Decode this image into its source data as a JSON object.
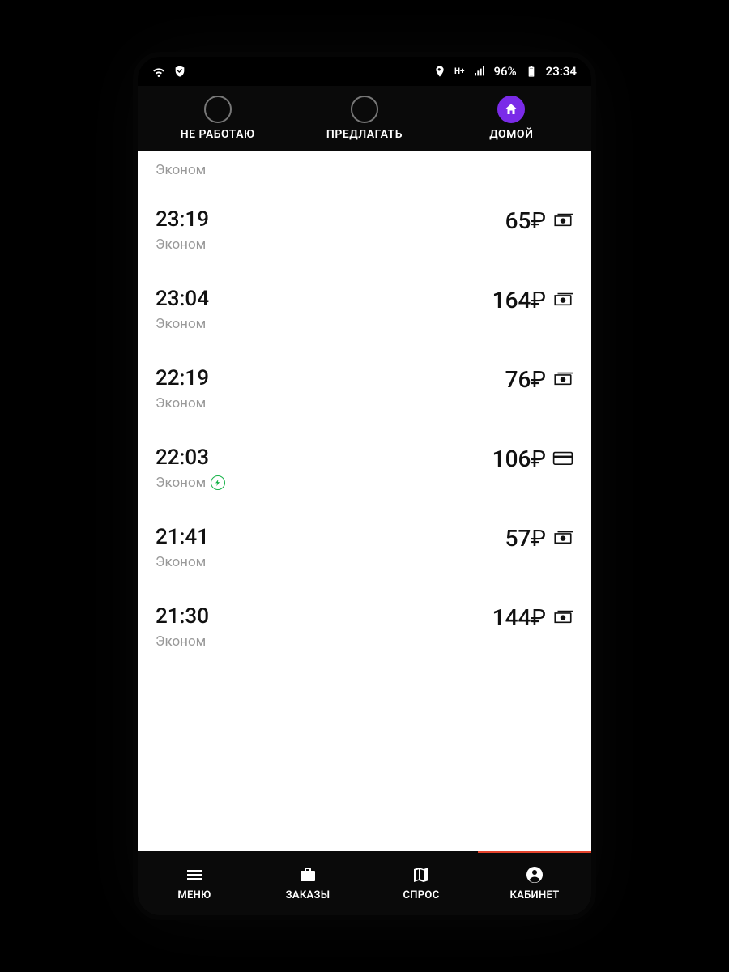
{
  "statusbar": {
    "battery": "96%",
    "clock": "23:34"
  },
  "toptabs": {
    "items": [
      {
        "label": "НЕ РАБОТАЮ",
        "active": false
      },
      {
        "label": "ПРЕДЛАГАТЬ",
        "active": false
      },
      {
        "label": "ДОМОЙ",
        "active": true
      }
    ]
  },
  "list_heading": "Эконом",
  "currency": "₽",
  "orders": [
    {
      "time": "23:19",
      "cls": "Эконом",
      "price": "65",
      "pay": "cash",
      "bolt": false
    },
    {
      "time": "23:04",
      "cls": "Эконом",
      "price": "164",
      "pay": "cash",
      "bolt": false
    },
    {
      "time": "22:19",
      "cls": "Эконом",
      "price": "76",
      "pay": "cash",
      "bolt": false
    },
    {
      "time": "22:03",
      "cls": "Эконом",
      "price": "106",
      "pay": "card",
      "bolt": true
    },
    {
      "time": "21:41",
      "cls": "Эконом",
      "price": "57",
      "pay": "cash",
      "bolt": false
    },
    {
      "time": "21:30",
      "cls": "Эконом",
      "price": "144",
      "pay": "cash",
      "bolt": false
    }
  ],
  "bottomnav": {
    "items": [
      {
        "label": "МЕНЮ"
      },
      {
        "label": "ЗАКАЗЫ"
      },
      {
        "label": "СПРОС"
      },
      {
        "label": "КАБИНЕТ"
      }
    ]
  }
}
